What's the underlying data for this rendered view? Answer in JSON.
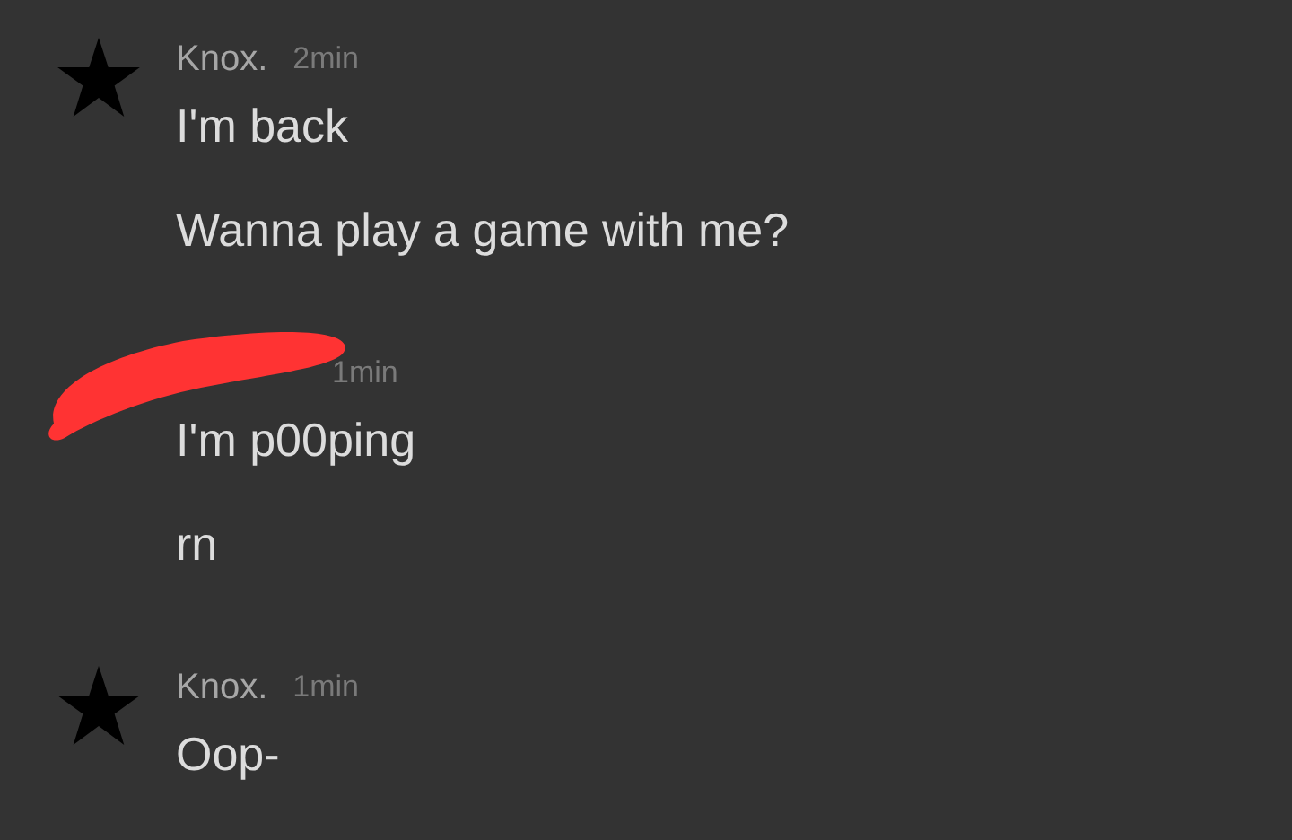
{
  "messages": [
    {
      "kind": "user",
      "author": "Knox.",
      "time": "2min",
      "lines": [
        "I'm back",
        "Wanna play a game with me?"
      ]
    },
    {
      "kind": "redacted",
      "time": "1min",
      "lines": [
        "I'm p00ping",
        "rn"
      ]
    },
    {
      "kind": "user",
      "author": "Knox.",
      "time": "1min",
      "lines": [
        "Oop-"
      ]
    }
  ]
}
